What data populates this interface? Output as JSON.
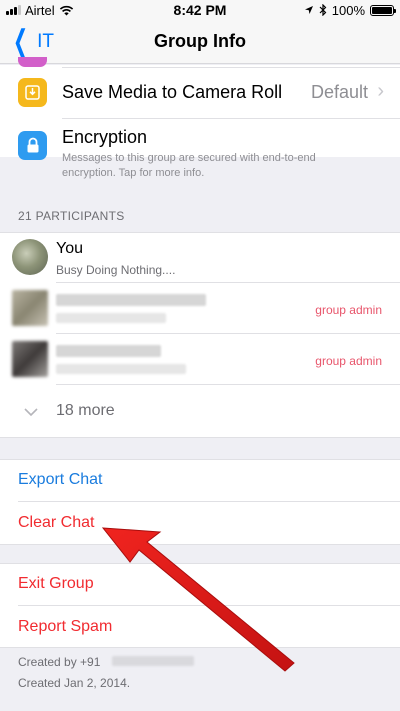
{
  "status_bar": {
    "carrier": "Airtel",
    "time": "8:42 PM",
    "battery": "100%",
    "battery_level": 1.0,
    "signal_bars_filled": 3,
    "signal_bars_total": 4
  },
  "nav": {
    "back_label": "IT",
    "title": "Group Info"
  },
  "settings": {
    "save_media": {
      "label": "Save Media to Camera Roll",
      "value": "Default",
      "icon": "download-icon",
      "icon_color": "#f5b81c"
    },
    "encryption": {
      "label": "Encryption",
      "description": "Messages to this group are secured with end-to-end encryption. Tap for more info.",
      "icon": "lock-icon",
      "icon_color": "#2e9bf0"
    }
  },
  "participants": {
    "header": "21 PARTICIPANTS",
    "you": {
      "name": "You",
      "status": "Busy Doing Nothing...."
    },
    "admins": [
      {
        "badge": "group admin"
      },
      {
        "badge": "group admin"
      }
    ],
    "more": "18 more"
  },
  "actions": {
    "export_chat": "Export Chat",
    "clear_chat": "Clear Chat",
    "exit_group": "Exit Group",
    "report_spam": "Report Spam"
  },
  "footer": {
    "created_by": "Created by +91",
    "created_date": "Created Jan 2, 2014."
  },
  "colors": {
    "accent_blue": "#1a7cde",
    "destructive_red": "#f12b30",
    "admin_pink": "#e8556b",
    "annotation_arrow": "#e01b1b"
  }
}
